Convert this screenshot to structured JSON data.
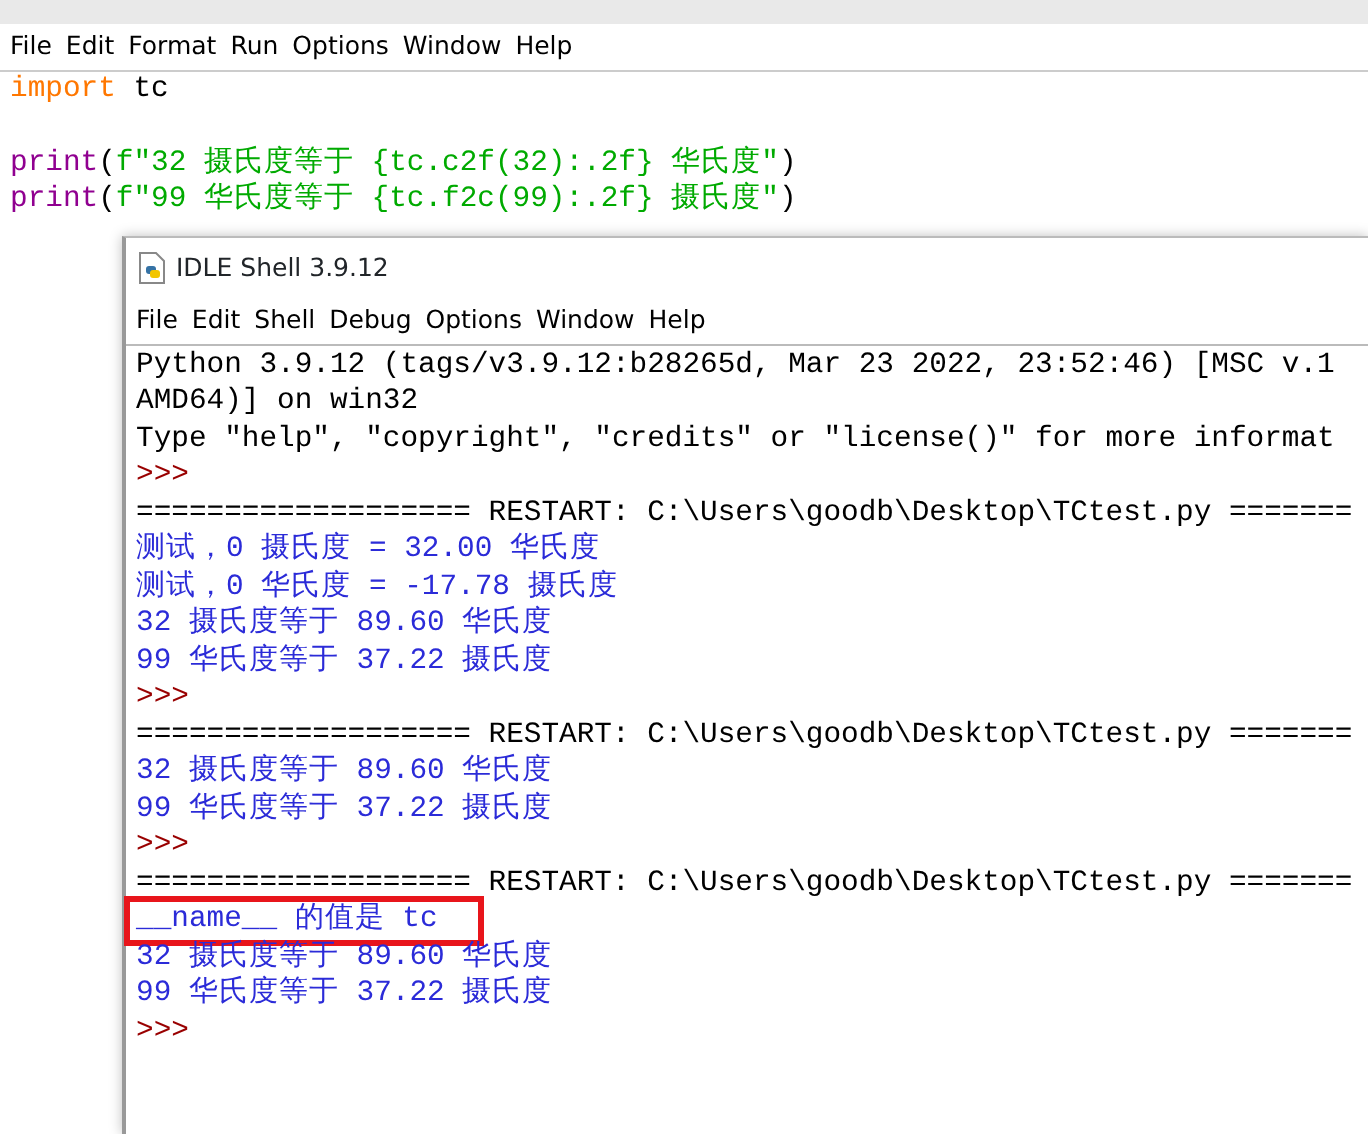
{
  "editor": {
    "menu": [
      "File",
      "Edit",
      "Format",
      "Run",
      "Options",
      "Window",
      "Help"
    ],
    "lines": [
      {
        "kind": "code",
        "tokens": [
          {
            "kind": "keyword",
            "text": "import"
          },
          {
            "kind": "plain",
            "text": " tc"
          }
        ]
      },
      {
        "kind": "blank"
      },
      {
        "kind": "code",
        "tokens": [
          {
            "kind": "builtin",
            "text": "print"
          },
          {
            "kind": "plain",
            "text": "("
          },
          {
            "kind": "string",
            "text": "f\"32 摄氏度等于 {tc.c2f(32):.2f} 华氏度\""
          },
          {
            "kind": "plain",
            "text": ")"
          }
        ]
      },
      {
        "kind": "code",
        "tokens": [
          {
            "kind": "builtin",
            "text": "print"
          },
          {
            "kind": "plain",
            "text": "("
          },
          {
            "kind": "string",
            "text": "f\"99 华氏度等于 {tc.f2c(99):.2f} 摄氏度\""
          },
          {
            "kind": "plain",
            "text": ")"
          }
        ]
      }
    ]
  },
  "shell": {
    "title": "IDLE Shell 3.9.12",
    "menu": [
      "File",
      "Edit",
      "Shell",
      "Debug",
      "Options",
      "Window",
      "Help"
    ],
    "lines": [
      {
        "kind": "plain",
        "text": "Python 3.9.12 (tags/v3.9.12:b28265d, Mar 23 2022, 23:52:46) [MSC v.1",
        "highlighted": false
      },
      {
        "kind": "plain",
        "text": "AMD64)] on win32",
        "highlighted": false
      },
      {
        "kind": "plain",
        "text": "Type \"help\", \"copyright\", \"credits\" or \"license()\" for more informat",
        "highlighted": false
      },
      {
        "kind": "prompt",
        "text": ">>>",
        "highlighted": false
      },
      {
        "kind": "plain",
        "text": "=================== RESTART: C:\\Users\\goodb\\Desktop\\TCtest.py =======",
        "highlighted": false
      },
      {
        "kind": "output",
        "text": "测试，0 摄氏度 = 32.00 华氏度",
        "highlighted": false
      },
      {
        "kind": "output",
        "text": "测试，0 华氏度 = -17.78 摄氏度",
        "highlighted": false
      },
      {
        "kind": "output",
        "text": "32 摄氏度等于 89.60 华氏度",
        "highlighted": false
      },
      {
        "kind": "output",
        "text": "99 华氏度等于 37.22 摄氏度",
        "highlighted": false
      },
      {
        "kind": "prompt",
        "text": ">>>",
        "highlighted": false
      },
      {
        "kind": "plain",
        "text": "=================== RESTART: C:\\Users\\goodb\\Desktop\\TCtest.py =======",
        "highlighted": false
      },
      {
        "kind": "output",
        "text": "32 摄氏度等于 89.60 华氏度",
        "highlighted": false
      },
      {
        "kind": "output",
        "text": "99 华氏度等于 37.22 摄氏度",
        "highlighted": false
      },
      {
        "kind": "prompt",
        "text": ">>>",
        "highlighted": false
      },
      {
        "kind": "plain",
        "text": "=================== RESTART: C:\\Users\\goodb\\Desktop\\TCtest.py =======",
        "highlighted": false
      },
      {
        "kind": "output",
        "text": "__name__ 的值是 tc",
        "highlighted": true
      },
      {
        "kind": "output",
        "text": "32 摄氏度等于 89.60 华氏度",
        "highlighted": false
      },
      {
        "kind": "output",
        "text": "99 华氏度等于 37.22 摄氏度",
        "highlighted": false
      },
      {
        "kind": "prompt",
        "text": ">>>",
        "highlighted": false
      }
    ]
  }
}
